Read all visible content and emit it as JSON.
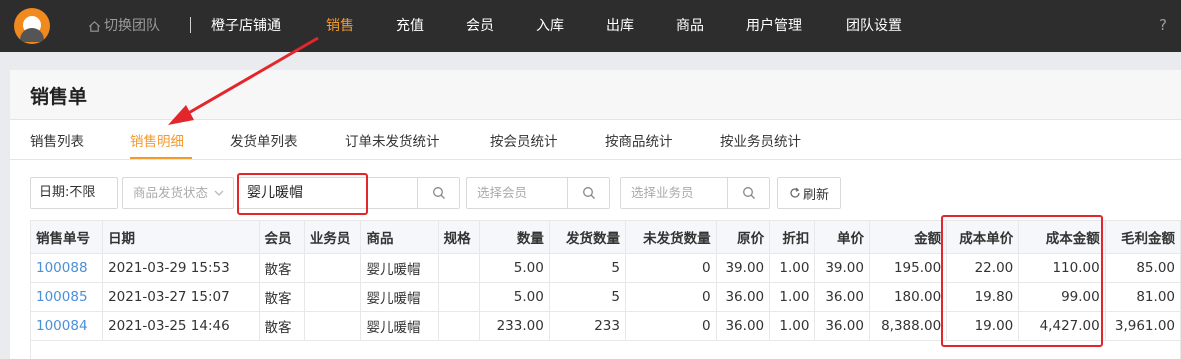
{
  "topnav": {
    "switch_team": "切换团队",
    "items": [
      "橙子店铺通",
      "销售",
      "充值",
      "会员",
      "入库",
      "出库",
      "商品",
      "用户管理",
      "团队设置"
    ],
    "active": "销售",
    "help": "?"
  },
  "page": {
    "title": "销售单",
    "tabs": [
      "销售列表",
      "销售明细",
      "发货单列表",
      "订单未发货统计",
      "按会员统计",
      "按商品统计",
      "按业务员统计"
    ],
    "active_tab": "销售明细"
  },
  "filters": {
    "date_label": "日期:不限",
    "ship_status_placeholder": "商品发货状态",
    "goods_value": "婴儿暖帽",
    "member_placeholder": "选择会员",
    "staff_placeholder": "选择业务员",
    "refresh_label": "刷新"
  },
  "table": {
    "columns": [
      "销售单号",
      "日期",
      "会员",
      "业务员",
      "商品",
      "规格",
      "数量",
      "发货数量",
      "未发货数量",
      "原价",
      "折扣",
      "单价",
      "金额",
      "成本单价",
      "成本金额",
      "毛利金额"
    ],
    "rows": [
      [
        "100088",
        "2021-03-29 15:53",
        "散客",
        "",
        "婴儿暖帽",
        "",
        "5.00",
        "5",
        "0",
        "39.00",
        "1.00",
        "39.00",
        "195.00",
        "22.00",
        "110.00",
        "85.00"
      ],
      [
        "100085",
        "2021-03-27 15:07",
        "散客",
        "",
        "婴儿暖帽",
        "",
        "5.00",
        "5",
        "0",
        "36.00",
        "1.00",
        "36.00",
        "180.00",
        "19.80",
        "99.00",
        "81.00"
      ],
      [
        "100084",
        "2021-03-25 14:46",
        "散客",
        "",
        "婴儿暖帽",
        "",
        "233.00",
        "233",
        "0",
        "36.00",
        "1.00",
        "36.00",
        "8,388.00",
        "19.00",
        "4,427.00",
        "3,961.00"
      ]
    ]
  },
  "colors": {
    "accent": "#f39a2c",
    "link": "#4a8fd8",
    "annotation": "#e3262b",
    "topbar": "#2d2d2d"
  }
}
